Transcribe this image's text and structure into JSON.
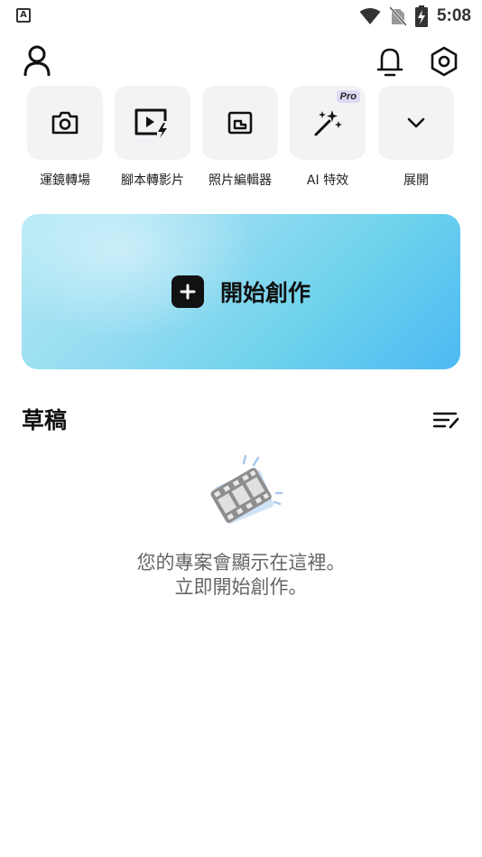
{
  "status_bar": {
    "app_icon_letter": "A",
    "time": "5:08"
  },
  "top_bar": {
    "profile_icon": "person-icon",
    "notifications_icon": "bell-icon",
    "settings_icon": "settings-hexagon-icon"
  },
  "tools": [
    {
      "label": "運鏡轉場",
      "icon": "camera-icon"
    },
    {
      "label": "腳本轉影片",
      "icon": "video-lightning-icon"
    },
    {
      "label": "照片編輯器",
      "icon": "photo-frame-icon"
    },
    {
      "label": "AI 特效",
      "icon": "magic-wand-icon",
      "badge": "Pro"
    },
    {
      "label": "展開",
      "icon": "chevron-down-icon"
    }
  ],
  "start_banner": {
    "label": "開始創作"
  },
  "drafts": {
    "title": "草稿",
    "empty_line1": "您的專案會顯示在這裡。",
    "empty_line2": "立即開始創作。"
  },
  "colors": {
    "banner_start": "#b3e9f5",
    "banner_end": "#4cb9f3",
    "tool_bg": "#f1f3f5",
    "pro_badge_bg": "#dcd9f5"
  }
}
